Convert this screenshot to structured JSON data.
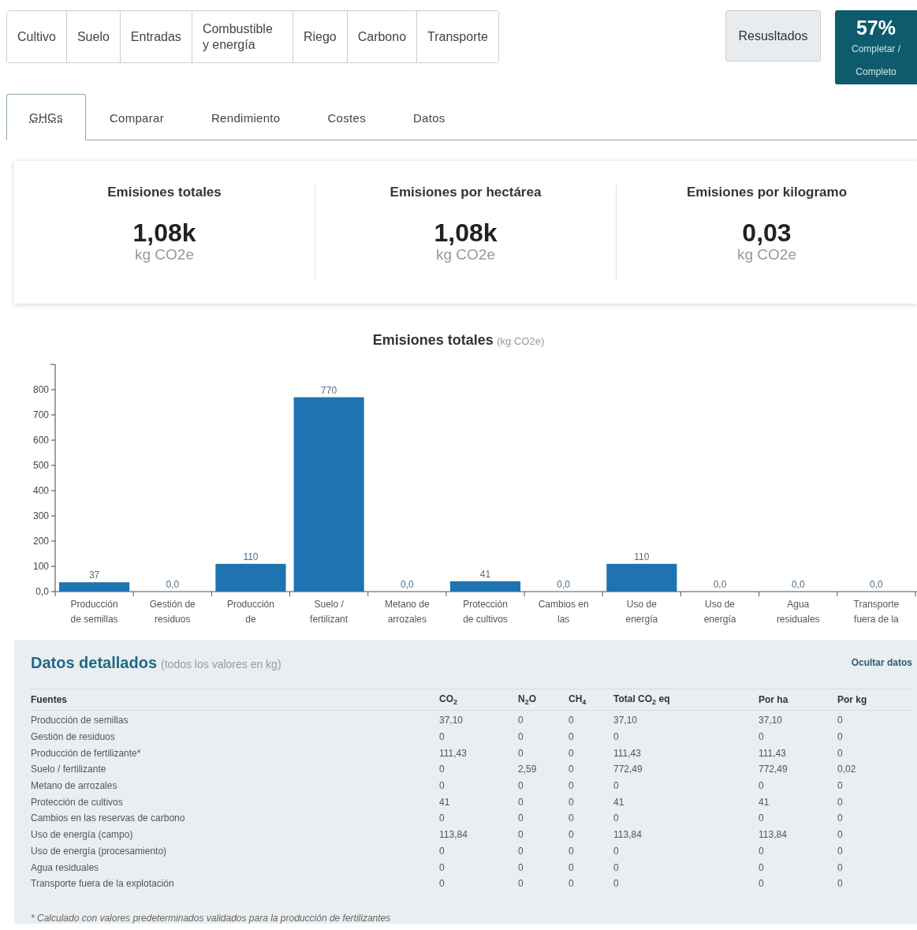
{
  "nav": {
    "steps": [
      {
        "label": "Cultivo"
      },
      {
        "label": "Suelo"
      },
      {
        "label": "Entradas"
      },
      {
        "label": "Combustible y energía"
      },
      {
        "label": "Riego"
      },
      {
        "label": "Carbono"
      },
      {
        "label": "Transporte"
      }
    ],
    "results_button": "Resusltados",
    "progress": {
      "percent": "57%",
      "label": "Completar / Completo"
    }
  },
  "tabs": [
    {
      "label": "GHGs",
      "selected": true
    },
    {
      "label": "Comparar",
      "selected": false
    },
    {
      "label": "Rendimiento",
      "selected": false
    },
    {
      "label": "Costes",
      "selected": false
    },
    {
      "label": "Datos",
      "selected": false
    }
  ],
  "summary": [
    {
      "title": "Emisiones totales",
      "value": "1,08k",
      "unit": "kg CO2e"
    },
    {
      "title": "Emisiones por hectárea",
      "value": "1,08k",
      "unit": "kg CO2e"
    },
    {
      "title": "Emisiones por kilogramo",
      "value": "0,03",
      "unit": "kg CO2e"
    }
  ],
  "chart": {
    "unit": "(kg CO2e)",
    "chart_data": {
      "type": "bar",
      "title": "Emisiones totales",
      "categories": [
        "Producción de semillas",
        "Gestión de residuos",
        "Producción de",
        "Suelo / fertilizant",
        "Metano de arrozales",
        "Protección de cultivos",
        "Cambios en las",
        "Uso de energía",
        "Uso de energía",
        "Agua residuales",
        "Transporte fuera de la"
      ],
      "series": [
        {
          "color": "#1f73b1",
          "values": [
            37,
            0,
            110,
            770,
            0,
            41,
            0,
            110,
            0,
            0,
            0
          ]
        }
      ],
      "value_labels": [
        "37",
        "0,0",
        "110",
        "770",
        "0,0",
        "41",
        "0,0",
        "110",
        "0,0",
        "0,0",
        "0,0"
      ],
      "ylim": [
        0,
        900
      ],
      "yticks": [
        {
          "value": 0,
          "label": "0,0"
        },
        100,
        200,
        300,
        400,
        500,
        600,
        700,
        800
      ]
    }
  },
  "details": {
    "title": "Datos detallados",
    "subtitle": "(todos los valores en kg)",
    "hide_link": "Ocultar datos",
    "columns": [
      "Fuentes",
      "CO$_{2}$",
      "N$_{2}$O",
      "CH$_{4}$",
      "Total CO$_{2}$ eq",
      "Por ha",
      "Por kg"
    ],
    "rows": [
      [
        "Producción de semillas",
        "37,10",
        "0",
        "0",
        "37,10",
        "37,10",
        "0"
      ],
      [
        "Gestión de residuos",
        "0",
        "0",
        "0",
        "0",
        "0",
        "0"
      ],
      [
        "Producción de fertilizante*",
        "111,43",
        "0",
        "0",
        "111,43",
        "111,43",
        "0"
      ],
      [
        "Suelo / fertilizante",
        "0",
        "2,59",
        "0",
        "772,49",
        "772,49",
        "0,02"
      ],
      [
        "Metano de arrozales",
        "0",
        "0",
        "0",
        "0",
        "0",
        "0"
      ],
      [
        "Protección de cultivos",
        "41",
        "0",
        "0",
        "41",
        "41",
        "0"
      ],
      [
        "Cambios en las reservas de carbono",
        "0",
        "0",
        "0",
        "0",
        "0",
        "0"
      ],
      [
        "Uso de energía (campo)",
        "113,84",
        "0",
        "0",
        "113,84",
        "113,84",
        "0"
      ],
      [
        "Uso de energía (procesamiento)",
        "0",
        "0",
        "0",
        "0",
        "0",
        "0"
      ],
      [
        "Agua residuales",
        "0",
        "0",
        "0",
        "0",
        "0",
        "0"
      ],
      [
        "Transporte fuera de la explotación",
        "0",
        "0",
        "0",
        "0",
        "0",
        "0"
      ]
    ],
    "footnote": "* Calculado con valores predeterminados validados para la producción de fertilizantes"
  }
}
